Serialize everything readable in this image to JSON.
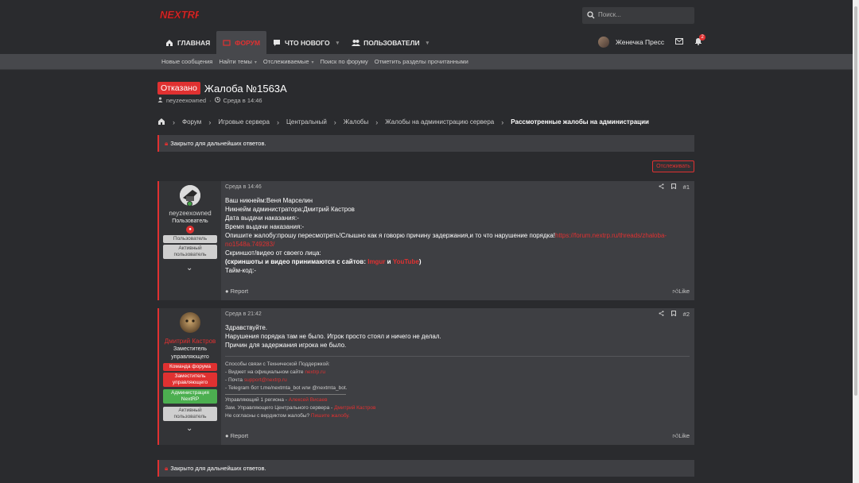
{
  "header": {
    "logo_text": "NEXTRP",
    "search_placeholder": "Поиск..."
  },
  "nav": [
    {
      "label": "ГЛАВНАЯ",
      "icon": "home-icon",
      "active": false,
      "dropdown": false
    },
    {
      "label": "ФОРУМ",
      "icon": "forum-icon",
      "active": true,
      "dropdown": false
    },
    {
      "label": "ЧТО НОВОГО",
      "icon": "chat-icon",
      "active": false,
      "dropdown": true
    },
    {
      "label": "ПОЛЬЗОВАТЕЛИ",
      "icon": "users-icon",
      "active": false,
      "dropdown": true
    }
  ],
  "user": {
    "name": "Женечка Пресс",
    "alerts_count": "2"
  },
  "subnav": [
    {
      "label": "Новые сообщения",
      "dropdown": false
    },
    {
      "label": "Найти темы",
      "dropdown": true
    },
    {
      "label": "Отслеживаемые",
      "dropdown": true
    },
    {
      "label": "Поиск по форуму",
      "dropdown": false
    },
    {
      "label": "Отметить разделы прочитанными",
      "dropdown": false
    }
  ],
  "thread": {
    "status": "Отказано",
    "title": "Жалоба №1563A",
    "author": "neyzeexowned",
    "date": "Среда в 14:46",
    "follow_label": "Отслеживать",
    "closed_notice": "Закрыто для дальнейших ответов."
  },
  "breadcrumbs": [
    "Форум",
    "Игровые сервера",
    "Центральный",
    "Жалобы",
    "Жалобы на администрацию сервера",
    "Рассмотренные жалобы на администрации"
  ],
  "posts": [
    {
      "author": "neyzeexowned",
      "title": "Пользователь",
      "banners": [
        "Пользователь",
        "Активный пользователь"
      ],
      "date": "Среда в 14:46",
      "number": "#1",
      "lines": {
        "l1": "Ваш никнейм:Веня Марселин",
        "l2": "Никнейм администратора:Дмитрий Кастров",
        "l3": "Дата выдачи наказания:-",
        "l4": "Время выдачи наказания:-",
        "l5": "Опишите жалобу:прошу пересмотреть!Слышно как я говорю причину задержания,и то что нарушение порядка!",
        "l5_link": "https://forum.nextrp.ru/threads/zhaloba-no1548a.749283/",
        "l6": "Скриншот/видео от своего лица:",
        "l7": "(скриншоты и видео принимаются с сайтов: ",
        "l7_link1": "Imgur",
        "l7_and": " и ",
        "l7_link2": "YouTube",
        "l7_end": ")",
        "l8": "Тайм-код:-"
      },
      "report": "Report",
      "like": "Like"
    },
    {
      "author": "Дмитрий Кастров",
      "title": "Заместитель управляющего",
      "banners": [
        "Команда форума",
        "Заместитель управляющего",
        "Администрация NextRP",
        "Активный пользователь"
      ],
      "date": "Среда в 21:42",
      "number": "#2",
      "lines": {
        "l1": "Здравствуйте.",
        "l2": "Нарушения порядка там не было. Игрок просто стоял и ничего не делал.",
        "l3": "Причин для задержания игрока не было."
      },
      "signature": {
        "s1": "Способы связи с Технической Поддержкой:",
        "s2": "- Виджет на официальном сайте ",
        "s2_link": "nextrp.ru",
        "s3": "- Почта ",
        "s3_link": "support@nextrp.ru",
        "s4": "- Telegram бот t.me/nextmta_bot или @nextmta_bot.",
        "s5": "Управляющий 1 региона - ",
        "s5_link": "Алексей Висаев",
        "s6": "Зам. Управляющего Центрального сервера - ",
        "s6_link": "Дмитрий Кастров",
        "s7": "Не согласны с вердиктом жалобы? ",
        "s7_link": "Пишите жалобу."
      },
      "report": "Report",
      "like": "Like"
    }
  ],
  "colors": {
    "accent": "#e03131",
    "bg": "#2a2b2e",
    "panel": "#3e3f43"
  }
}
